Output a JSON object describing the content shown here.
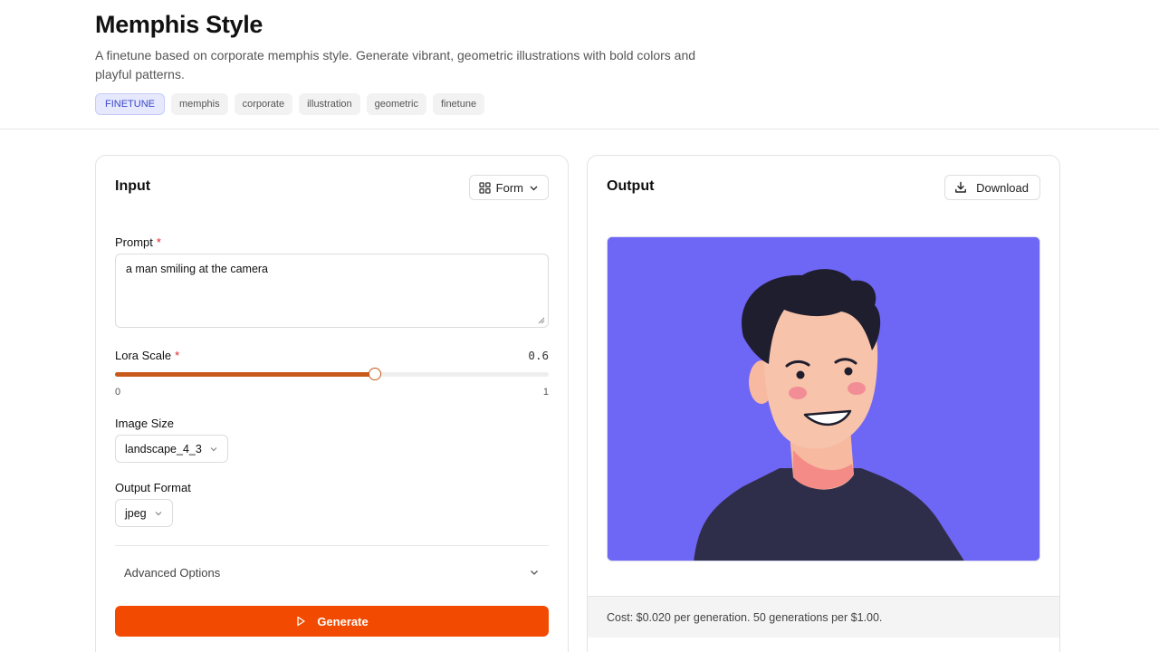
{
  "header": {
    "title": "Memphis Style",
    "description": "A finetune based on corporate memphis style. Generate vibrant, geometric illustrations with bold colors and playful patterns.",
    "tags": [
      "FINETUNE",
      "memphis",
      "corporate",
      "illustration",
      "geometric",
      "finetune"
    ]
  },
  "input": {
    "title": "Input",
    "mode_button": "Form",
    "prompt": {
      "label": "Prompt",
      "required_mark": "*",
      "value": "a man smiling at the camera"
    },
    "lora_scale": {
      "label": "Lora Scale",
      "required_mark": "*",
      "value": "0.6",
      "fraction": 0.6,
      "min": "0",
      "max": "1"
    },
    "image_size": {
      "label": "Image Size",
      "value": "landscape_4_3"
    },
    "output_format": {
      "label": "Output Format",
      "value": "jpeg"
    },
    "advanced_label": "Advanced Options",
    "generate_label": "Generate"
  },
  "output": {
    "title": "Output",
    "download_label": "Download",
    "cost_text": "Cost: $0.020 per generation. 50 generations per $1.00."
  },
  "colors": {
    "accent": "#f24a00",
    "slider": "#c85a19",
    "tag_primary_bg": "#e6e9fd",
    "tag_primary_text": "#3b47c9",
    "image_bg": "#6e66f4"
  },
  "icons": {
    "form": "grid-icon",
    "chevron": "chevron-down-icon",
    "download": "download-icon",
    "play": "play-icon"
  }
}
